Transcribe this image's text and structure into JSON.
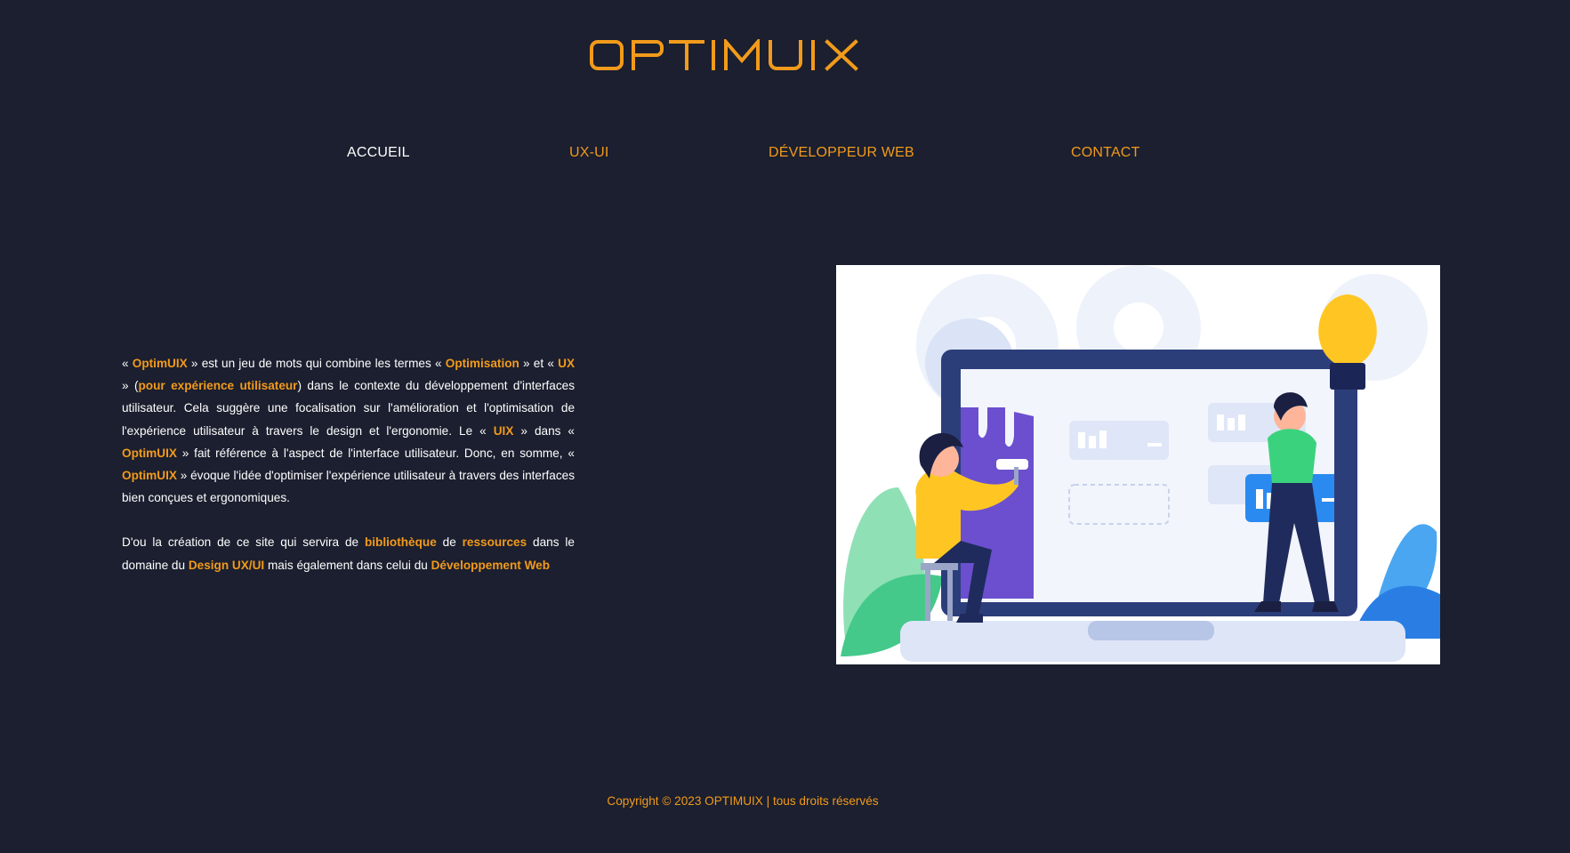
{
  "brand": {
    "logo_text": "OPTIMUIX",
    "accent_color": "#f29a1b",
    "background_color": "#1b1f2f"
  },
  "nav": {
    "items": [
      {
        "label": "ACCUEIL",
        "active": true
      },
      {
        "label": "UX-UI",
        "active": false
      },
      {
        "label": "DÉVELOPPEUR WEB",
        "active": false
      },
      {
        "label": "CONTACT",
        "active": false
      }
    ]
  },
  "intro": {
    "p1": {
      "t1": "« ",
      "h1": "OptimUIX",
      "t2": " » est un jeu de mots qui combine les termes « ",
      "h2": "Optimisation",
      "t3": " » et « ",
      "h3": "UX",
      "t4": " » (",
      "h4": "pour expérience utilisateur",
      "t5": ") dans le contexte du développement d'interfaces utilisateur. Cela suggère une focalisation sur l'amélioration et l'optimisation de l'expérience utilisateur à travers le design et l'ergonomie. Le « ",
      "h5": "UIX",
      "t6": " » dans « ",
      "h6": "OptimUIX",
      "t7": " » fait référence à l'aspect de l'interface utilisateur. Donc, en somme, « ",
      "h7": "OptimUIX",
      "t8": " » évoque l'idée d'optimiser l'expérience utilisateur à travers des interfaces bien conçues et ergonomiques."
    },
    "p2": {
      "t1": "D'ou la création de ce site qui servira de ",
      "h1": "bibliothèque",
      "t2": " de ",
      "h2": "ressources",
      "t3": " dans le domaine du ",
      "h3": "Design UX/UI",
      "t4": " mais également dans celui du ",
      "h4": "Développement Web"
    }
  },
  "illustration": {
    "icon": "ux-design-team-illustration"
  },
  "footer": {
    "copyright": "Copyright © 2023 OPTIMUIX | tous droits réservés"
  }
}
